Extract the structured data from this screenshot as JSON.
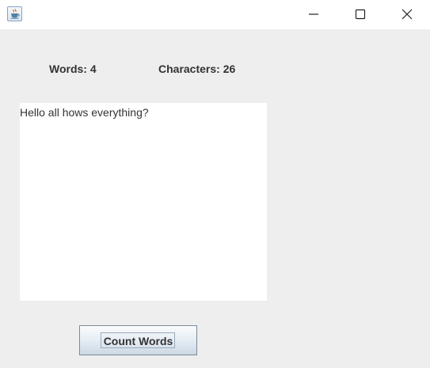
{
  "window": {
    "icon": "java-coffee-cup-icon",
    "controls": [
      "minimize-icon",
      "maximize-icon",
      "close-icon"
    ]
  },
  "stats": {
    "words_label": "Words: 4",
    "characters_label": "Characters: 26"
  },
  "editor": {
    "text": "Hello all hows everything?"
  },
  "actions": {
    "count_button_label": "Count Words"
  }
}
